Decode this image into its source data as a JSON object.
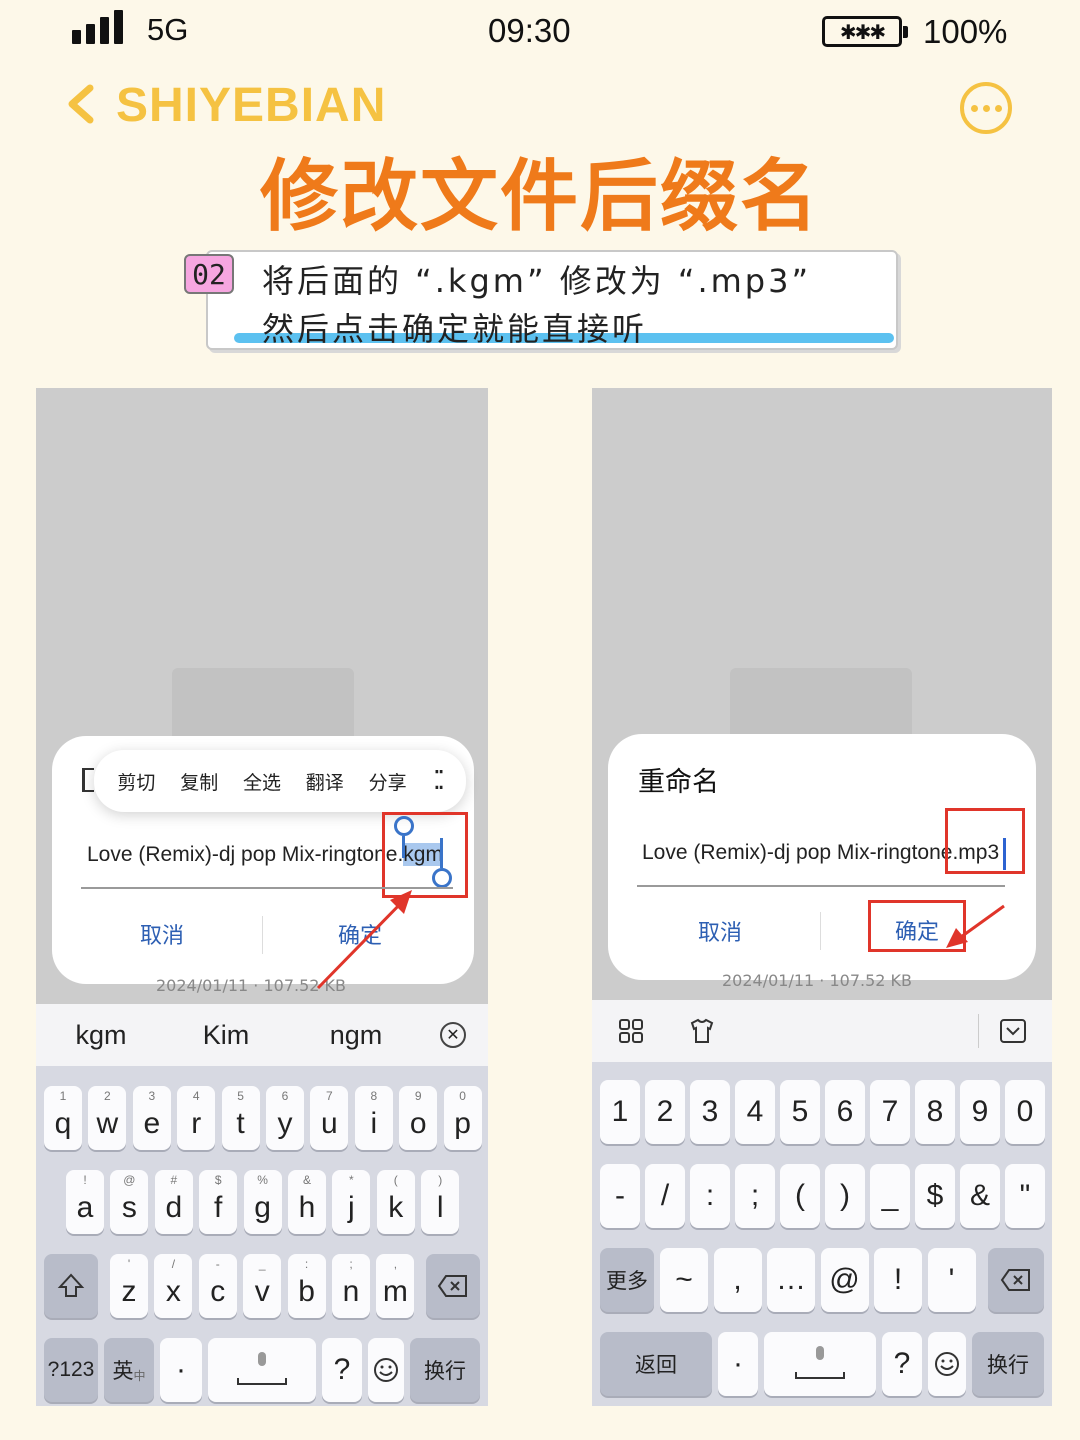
{
  "status_bar": {
    "network": "5G",
    "time": "09:30",
    "battery": "100%"
  },
  "header": {
    "brand": "SHIYEBIAN",
    "back_icon": "chevron-left-icon",
    "more_icon": "more-dots-icon"
  },
  "title": "修改文件后缀名",
  "caption": {
    "step": "02",
    "line1": "将后面的 “.kgm” 修改为 “.mp3”",
    "line2": "然后点击确定就能直接听"
  },
  "left_phone": {
    "context_menu": [
      "剪切",
      "复制",
      "全选",
      "翻译",
      "分享"
    ],
    "filename_base": "Love (Remix)-dj pop Mix-ringtone.",
    "filename_ext": "kgm",
    "cancel": "取消",
    "confirm": "确定",
    "under_text": "2024/01/11 · 107.52 KB",
    "suggestions": [
      "kgm",
      "Kim",
      "ngm"
    ],
    "row1": [
      [
        "q",
        "1"
      ],
      [
        "w",
        "2"
      ],
      [
        "e",
        "3"
      ],
      [
        "r",
        "4"
      ],
      [
        "t",
        "5"
      ],
      [
        "y",
        "6"
      ],
      [
        "u",
        "7"
      ],
      [
        "i",
        "8"
      ],
      [
        "o",
        "9"
      ],
      [
        "p",
        "0"
      ]
    ],
    "row2": [
      [
        "a",
        "!"
      ],
      [
        "s",
        "@"
      ],
      [
        "d",
        "#"
      ],
      [
        "f",
        "$"
      ],
      [
        "g",
        "%"
      ],
      [
        "h",
        "&"
      ],
      [
        "j",
        "*"
      ],
      [
        "k",
        "("
      ],
      [
        "l",
        ")"
      ]
    ],
    "row3": [
      [
        "z",
        "'"
      ],
      [
        "x",
        "/"
      ],
      [
        "c",
        "-"
      ],
      [
        "v",
        "_"
      ],
      [
        "b",
        ":"
      ],
      [
        "n",
        ";"
      ],
      [
        "m",
        ","
      ]
    ],
    "sym_key": "?123",
    "lang_key": "英",
    "lang_sub": "中",
    "dot_key": "·",
    "question_key": "?",
    "enter_key": "换行"
  },
  "right_phone": {
    "dialog_title": "重命名",
    "filename_base": "Love (Remix)-dj pop Mix-ringtone",
    "filename_ext": ".mp3",
    "cancel": "取消",
    "confirm": "确定",
    "under_text": "2024/01/11 · 107.52 KB",
    "num_row": [
      "1",
      "2",
      "3",
      "4",
      "5",
      "6",
      "7",
      "8",
      "9",
      "0"
    ],
    "sym_row": [
      "-",
      "/",
      ":",
      ";",
      "(",
      ")",
      "_",
      "$",
      "&",
      "\""
    ],
    "row3": [
      "~",
      ",",
      "…",
      "@",
      "!",
      "'"
    ],
    "more_key": "更多",
    "back_key": "返回",
    "dot_key": "·",
    "question_key": "?",
    "enter_key": "换行"
  },
  "colors": {
    "brand": "#f5c242",
    "title": "#ef7a1a",
    "highlight": "#5cc1f0",
    "badge": "#f6a6e0",
    "annotation": "#e0352a",
    "link": "#2d5fb3"
  }
}
